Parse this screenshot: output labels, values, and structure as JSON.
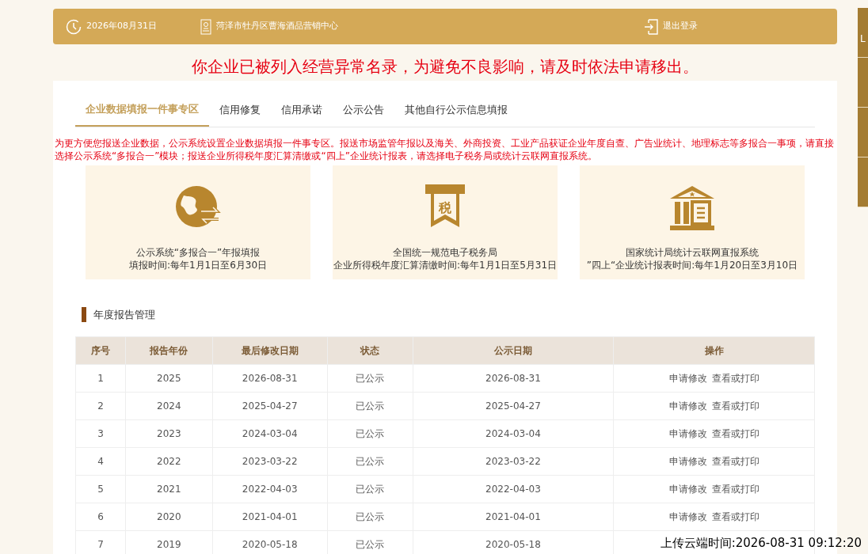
{
  "header": {
    "date": "2026年08月31日",
    "organization": "菏泽市牡丹区曹海酒品营销中心",
    "logout": "退出登录"
  },
  "warning": "你企业已被列入经营异常名录，为避免不良影响，请及时依法申请移出。",
  "tabs": [
    {
      "label": "企业数据填报一件事专区",
      "selected": true
    },
    {
      "label": "信用修复",
      "selected": false
    },
    {
      "label": "信用承诺",
      "selected": false
    },
    {
      "label": "公示公告",
      "selected": false
    },
    {
      "label": "其他自行公示信息填报",
      "selected": false
    }
  ],
  "notice": "为更方便您报送企业数据，公示系统设置企业数据填报一件事专区。报送市场监管年报以及海关、外商投资、工业产品获证企业年度自查、广告业统计、地理标志等多报合一事项，请直接选择公示系统“多报合一”模块；报送企业所得税年度汇算清缴或“四上”企业统计报表，请选择电子税务局或统计云联网直报系统。",
  "services": [
    {
      "kind": "globe",
      "title": "公示系统“多报合一”年报填报",
      "period": "填报时间:每年1月1日至6月30日"
    },
    {
      "kind": "tax",
      "icon_text": "税",
      "title": "全国统一规范电子税务局",
      "period": "企业所得税年度汇算清缴时间:每年1月1日至5月31日"
    },
    {
      "kind": "building",
      "title": "国家统计局统计云联网直报系统",
      "period": "”四上“企业统计报表时间:每年1月20日至3月10日"
    }
  ],
  "section_title": "年度报告管理",
  "table": {
    "columns": [
      "序号",
      "报告年份",
      "最后修改日期",
      "状态",
      "公示日期",
      "操作"
    ],
    "rows": [
      {
        "cells": [
          "1",
          "2025",
          "2026-08-31",
          "已公示",
          "2026-08-31"
        ],
        "actions": [
          "申请修改",
          "查看或打印"
        ]
      },
      {
        "cells": [
          "2",
          "2024",
          "2025-04-27",
          "已公示",
          "2025-04-27"
        ],
        "actions": [
          "申请修改",
          "查看或打印"
        ]
      },
      {
        "cells": [
          "3",
          "2023",
          "2024-03-04",
          "已公示",
          "2024-03-04"
        ],
        "actions": [
          "申请修改",
          "查看或打印"
        ]
      },
      {
        "cells": [
          "4",
          "2022",
          "2023-03-22",
          "已公示",
          "2023-03-22"
        ],
        "actions": [
          "申请修改",
          "查看或打印"
        ]
      },
      {
        "cells": [
          "5",
          "2021",
          "2022-04-03",
          "已公示",
          "2022-04-03"
        ],
        "actions": [
          "申请修改",
          "查看或打印"
        ]
      },
      {
        "cells": [
          "6",
          "2020",
          "2021-04-01",
          "已公示",
          "2021-04-01"
        ],
        "actions": [
          "申请修改",
          "查看或打印"
        ]
      },
      {
        "cells": [
          "7",
          "2019",
          "2020-05-18",
          "已公示",
          "2020-05-18"
        ],
        "actions": []
      }
    ]
  },
  "side_tabs": [
    {
      "kind": "text",
      "label": "L"
    },
    {
      "kind": "blank"
    },
    {
      "kind": "blank"
    },
    {
      "kind": "blank"
    }
  ],
  "upload_time": "上传云端时间:2026-08-31 09:12:20"
}
